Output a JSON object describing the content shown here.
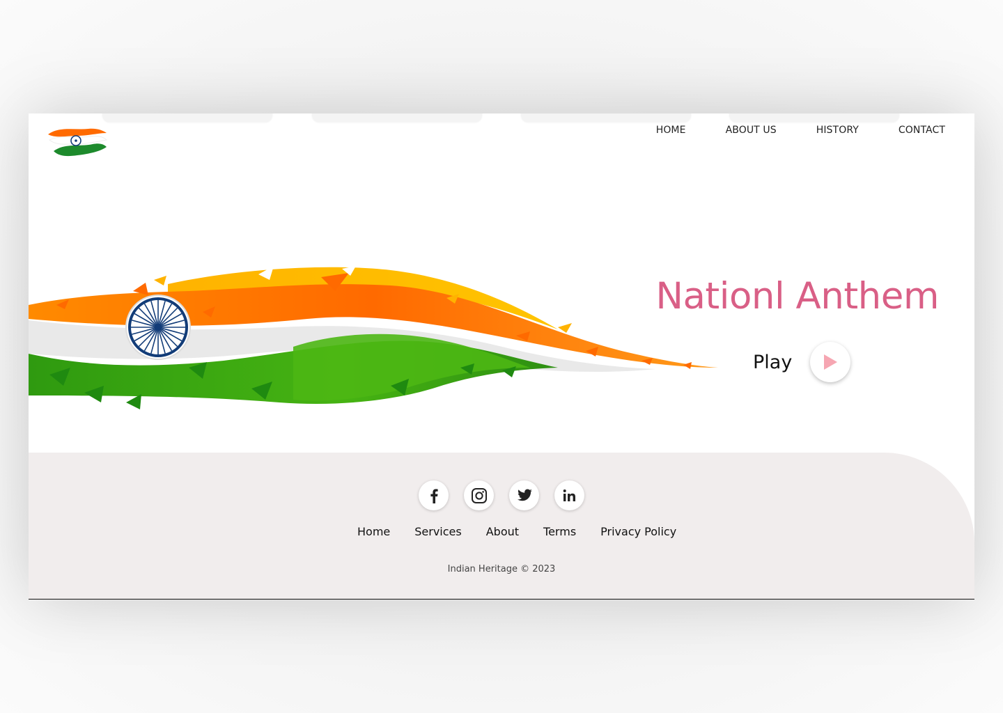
{
  "nav": {
    "items": [
      {
        "label": "HOME"
      },
      {
        "label": "ABOUT US"
      },
      {
        "label": "HISTORY"
      },
      {
        "label": "CONTACT"
      }
    ]
  },
  "hero": {
    "title": "Nationl Anthem",
    "play_label": "Play",
    "icons": {
      "play": "play-icon"
    }
  },
  "footer": {
    "social": [
      {
        "icon": "facebook-icon"
      },
      {
        "icon": "instagram-icon"
      },
      {
        "icon": "twitter-icon"
      },
      {
        "icon": "linkedin-icon"
      }
    ],
    "links": [
      {
        "label": "Home"
      },
      {
        "label": "Services"
      },
      {
        "label": "About"
      },
      {
        "label": "Terms"
      },
      {
        "label": "Privacy Policy"
      }
    ],
    "copyright": "Indian Heritage © 2023"
  },
  "colors": {
    "accent": "#d95f86",
    "saffron": "#ff6a00",
    "green": "#3aa70f",
    "chakra": "#123c78",
    "footer_bg": "#f1eded"
  }
}
